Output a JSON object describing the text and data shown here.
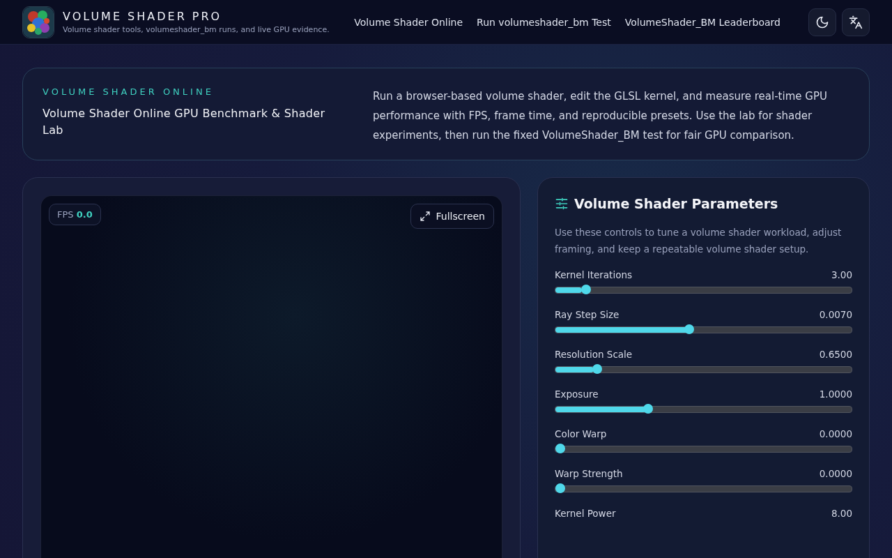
{
  "header": {
    "title": "VOLUME SHADER PRO",
    "subtitle": "Volume shader tools, volumeshader_bm runs, and live GPU evidence.",
    "nav": [
      {
        "label": "Volume Shader Online"
      },
      {
        "label": "Run volumeshader_bm Test"
      },
      {
        "label": "VolumeShader_BM Leaderboard"
      }
    ]
  },
  "hero": {
    "eyebrow": "VOLUME SHADER ONLINE",
    "heading": "Volume Shader Online GPU Benchmark & Shader Lab",
    "description": "Run a browser-based volume shader, edit the GLSL kernel, and measure real-time GPU performance with FPS, frame time, and reproducible presets. Use the lab for shader experiments, then run the fixed VolumeShader_BM test for fair GPU comparison."
  },
  "viewer": {
    "fps_label": "FPS",
    "fps_value": "0.0",
    "fullscreen": "Fullscreen"
  },
  "parameters": {
    "title": "Volume Shader Parameters",
    "description": "Use these controls to tune a volume shader workload, adjust framing, and keep a repeatable volume shader setup.",
    "sliders": [
      {
        "label": "Kernel Iterations",
        "reading": "3.00",
        "level": 0.09
      },
      {
        "label": "Ray Step Size",
        "reading": "0.0070",
        "level": 0.45
      },
      {
        "label": "Resolution Scale",
        "reading": "0.6500",
        "level": 0.13
      },
      {
        "label": "Exposure",
        "reading": "1.0000",
        "level": 0.306
      },
      {
        "label": "Color Warp",
        "reading": "0.0000",
        "level": 0
      },
      {
        "label": "Warp Strength",
        "reading": "0.0000",
        "level": 0
      },
      {
        "label": "Kernel Power",
        "reading": "8.00"
      }
    ]
  }
}
